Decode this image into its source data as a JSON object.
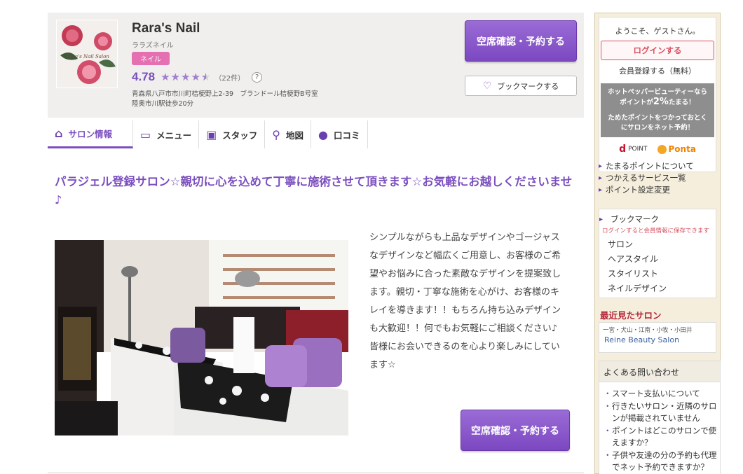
{
  "salon": {
    "name": "Rara's Nail",
    "kana": "ララズネイル",
    "genre": "ネイル",
    "rating": "4.78",
    "stars_value": 4.78,
    "review_count": "（22件）",
    "help": "?",
    "address_line1": "青森県八戸市市川町桔梗野上2-39　ブランドール桔梗野B号室",
    "address_line2": "陸奥市川駅徒歩20分",
    "thumb_logo_text": "Rara's Nail Salon"
  },
  "actions": {
    "reserve_label": "空席確認・予約する",
    "bookmark_label": "ブックマークする"
  },
  "tabs": [
    {
      "label": "サロン情報",
      "icon": "home-icon"
    },
    {
      "label": "メニュー",
      "icon": "menu-book-icon"
    },
    {
      "label": "スタッフ",
      "icon": "staff-card-icon"
    },
    {
      "label": "地図",
      "icon": "map-pin-icon"
    },
    {
      "label": "口コミ",
      "icon": "speech-bubble-icon"
    }
  ],
  "catch_copy": "パラジェル登録サロン☆親切に心を込めて丁寧に施術させて頂きます☆お気軽にお越しくださいませ♪",
  "description": "シンプルながらも上品なデザインやゴージャスなデザインなど幅広くご用意し、お客様のご希望やお悩みに合った素敵なデザインを提案致します。親切・丁寧な施術を心がけ、お客様のキレイを導きます！！もちろん持ち込みデザインも大歓迎！！何でもお気軽にご相談ください♪皆様にお会いできるのを心より楽しみにしています☆",
  "sidebar": {
    "welcome": "ようこそ、ゲストさん。",
    "login": "ログインする",
    "register": "会員登録する（無料）",
    "promo_line1": "ホットペッパービューティーなら",
    "promo_line2_pre": "ポイントが",
    "promo_pct": "2%",
    "promo_line2_post": "たまる！",
    "promo_line3": "ためたポイントをつかっておとく",
    "promo_line4": "にサロンをネット予約！",
    "dpoint": "POINT",
    "ponta": "Ponta",
    "links": [
      "たまるポイントについて",
      "つかえるサービス一覧",
      "ポイント設定変更"
    ],
    "bookmark_title": "ブックマーク",
    "bookmark_note": "ログインすると会員情報に保存できます",
    "bookmark_items": [
      "サロン",
      "ヘアスタイル",
      "スタイリスト",
      "ネイルデザイン"
    ],
    "recent_title": "最近見たサロン",
    "recent_area": "一宮・犬山・江南・小牧・小田井",
    "recent_name": "Reine Beauty Salon",
    "faq_title": "よくある問い合わせ",
    "faq": [
      "スマート支払いについて",
      "行きたいサロン・近隣のサロンが掲載されていません",
      "ポイントはどこのサロンで使えますか？",
      "子供や友達の分の予約も代理でネット予約できますか？"
    ]
  },
  "colors": {
    "accent": "#7b4fbf",
    "genre": "#e46fb1",
    "login": "#d84f5e",
    "recent": "#b5243a"
  }
}
